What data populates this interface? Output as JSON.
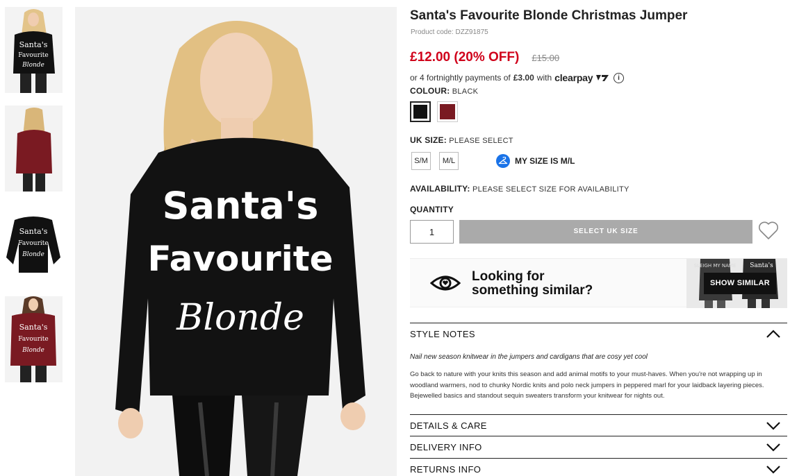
{
  "product": {
    "title": "Santa's Favourite Blonde Christmas Jumper",
    "code": "Product code: DZZ91875",
    "price_now": "£12.00 (20% OFF)",
    "price_was": "£15.00",
    "installments_pre": "or 4 fortnightly payments of",
    "installments_amount": "£3.00",
    "installments_with": "with",
    "clearpay_brand": "clearpay",
    "info_glyph": "i"
  },
  "jumper_print": {
    "line1": "Santa's",
    "line2": "Favourite",
    "line3": "Blonde"
  },
  "colour": {
    "label": "COLOUR:",
    "value": "BLACK",
    "swatches": [
      {
        "name": "black",
        "hex": "#111111",
        "selected": true
      },
      {
        "name": "burgundy",
        "hex": "#7a1a22",
        "selected": false
      }
    ]
  },
  "size": {
    "label": "UK SIZE:",
    "value": "PLEASE SELECT",
    "options": [
      "S/M",
      "M/L"
    ],
    "my_size": "MY SIZE IS M/L"
  },
  "availability": {
    "label": "AVAILABILITY:",
    "value": "PLEASE SELECT SIZE FOR AVAILABILITY"
  },
  "quantity": {
    "label": "QUANTITY",
    "value": "1"
  },
  "add_button": "SELECT UK SIZE",
  "similar": {
    "line1": "Looking for",
    "line2": "something similar?",
    "button": "SHOW SIMILAR",
    "thumb_text_1": "SLEIGH MY NAME",
    "thumb_text_2": "Santa's"
  },
  "accordions": {
    "style_notes": "STYLE NOTES",
    "style_lead": "Nail new season knitwear in the jumpers and cardigans that are cosy yet cool",
    "style_body": "Go back to nature with your knits this season and add animal motifs to your must-haves. When you're not wrapping up in woodland warmers, nod to chunky Nordic knits and polo neck jumpers in peppered marl for your laidback layering pieces. Bejewelled basics and standout sequin sweaters transform your knitwear for nights out.",
    "details": "DETAILS & CARE",
    "delivery": "DELIVERY INFO",
    "returns": "RETURNS INFO"
  },
  "colors": {
    "price_red": "#d0021b",
    "button_grey": "#aaaaaa",
    "my_size_blue": "#1a73e8"
  }
}
